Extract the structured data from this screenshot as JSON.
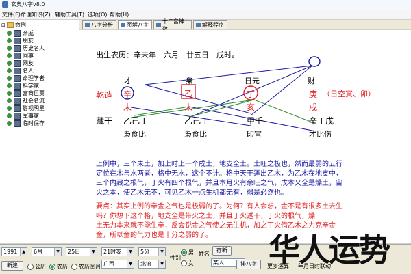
{
  "window": {
    "title": "玄奥八字v8.0"
  },
  "menu": [
    "文件(F)",
    "命理知识(Z)",
    "辅助工具(T)",
    "选项(O)",
    "帮助(H)"
  ],
  "tree": {
    "root": "命例",
    "items": [
      "亲戚",
      "朋友",
      "历史名人",
      "同事",
      "网友",
      "名人",
      "命理学者",
      "科学家",
      "富商巨贾",
      "社会名流",
      "影视明星",
      "军事家",
      "临时保存"
    ]
  },
  "tabs": [
    "八字分析",
    "图解八字",
    "十二宫神数",
    "解释程序"
  ],
  "chart": {
    "header": "出生农历：辛未年　六月　廿五日　戌时。",
    "gods": [
      "才",
      "枭",
      "日元",
      "财"
    ],
    "row_label": "乾造",
    "stems": [
      "辛",
      "乙",
      "丁",
      "庚"
    ],
    "branches": [
      "未",
      "未",
      "亥",
      "戌"
    ],
    "kong": "（日空寅、卯）",
    "canggan_label": "藏干",
    "canggan": [
      "乙己丁",
      "乙己丁",
      "甲壬",
      "辛丁戊"
    ],
    "canggan_gods": [
      "枭食比",
      "枭食比",
      "印官",
      "才比伤"
    ]
  },
  "analysis": {
    "para1": [
      "上例中，三个未土，加上时上一个戌土，地支全土。土旺之极也，然而最弱的五行",
      "定位在木与水两者，格中无水，这个不计。格中天干蓬出乙木，为乙木在地支中，",
      "三个内藏之根气，丁火有四个根气，并且本月火有余旺之气，戊本又全是燥土，宙",
      "火之本，使乙木无不，可见乙木一点生机都无有，弱是必然也。"
    ],
    "para2": [
      "要点：其实上例的辛金之气也是极弱的了。为何？有人会想，金不是有很多土去生",
      "吗？你想下这个格，地支全是带火之土，并且丁火透干，丁火的根气，燥",
      "土无力本来就不能生辛，反会锐金之气使之无生机，加之丁火借乙木之力克辛金",
      "金，所以金的气力也是十分之弱的了。"
    ]
  },
  "controls": {
    "year": "1991",
    "month": "6月",
    "day": "25日",
    "hour": "21时亥",
    "minute": "5分",
    "gender_label": "性别",
    "gender_options": [
      "男",
      "女"
    ],
    "name_label": "姓名",
    "name_value": "某人",
    "save_label": "存新",
    "new_btn": "新建",
    "calendar_options": [
      "公历",
      "农历",
      "农历闰月"
    ],
    "province": "广西",
    "city": "北流",
    "paipan_btn": "排八字",
    "more": "更多运算",
    "time_fmt": "年月日时联动"
  },
  "watermark": "华人运势",
  "colors": {
    "red": "#e02020",
    "blue": "#1a1aa0",
    "green": "#2a8a2a"
  }
}
